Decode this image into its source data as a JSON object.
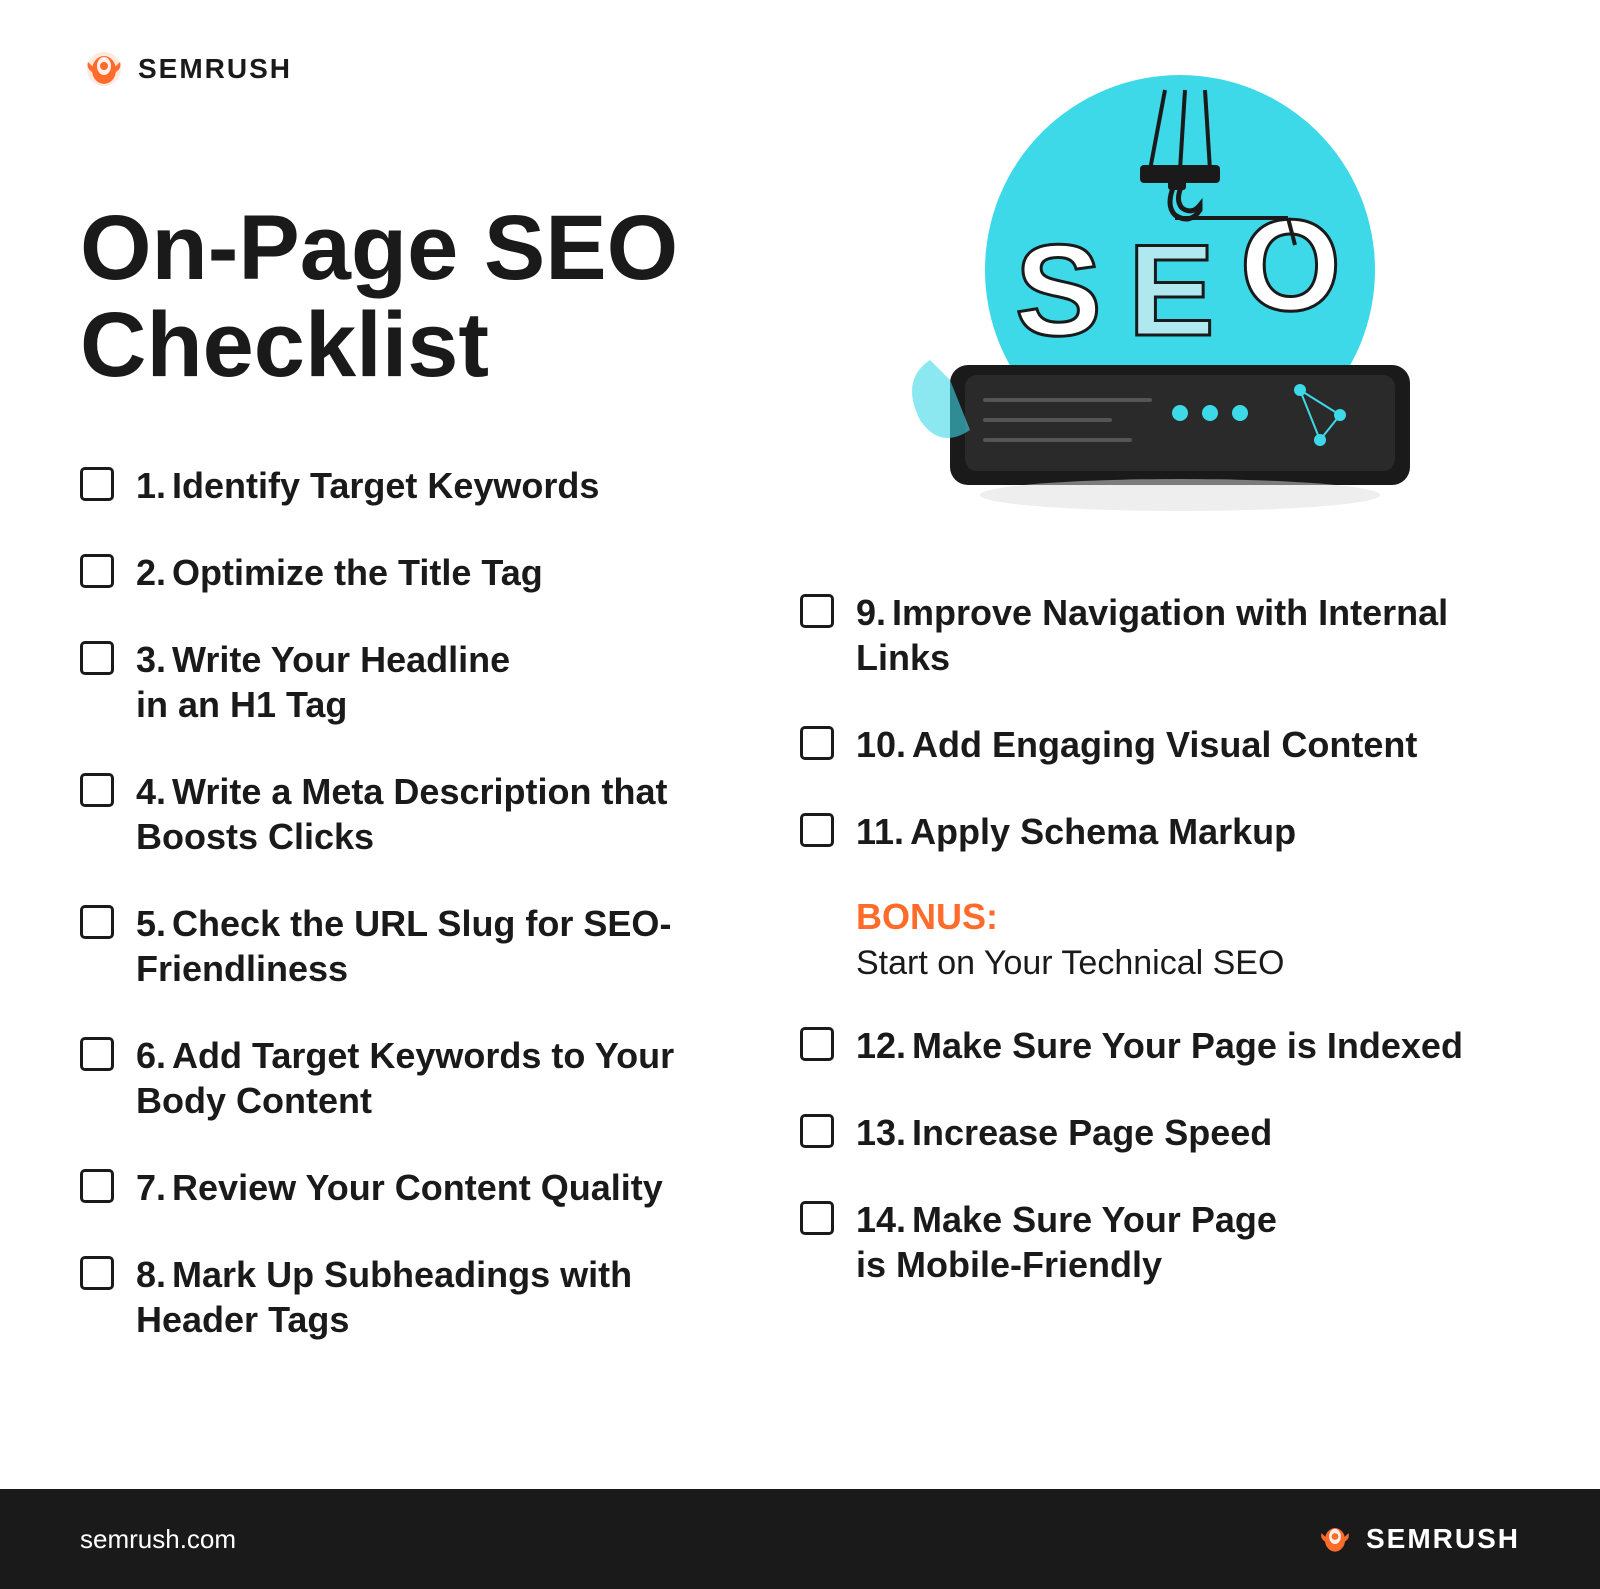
{
  "brand": {
    "name": "SEMRUSH",
    "website": "semrush.com",
    "color_primary": "#ff6b2b",
    "color_dark": "#1a1a1a",
    "color_light_blue": "#3dd9e8"
  },
  "page": {
    "title_line1": "On-Page SEO",
    "title_line2": "Checklist"
  },
  "left_items": [
    {
      "number": "1.",
      "text": "Identify Target Keywords"
    },
    {
      "number": "2.",
      "text": "Optimize the Title Tag"
    },
    {
      "number": "3.",
      "text": "Write Your Headline\nin an H1 Tag"
    },
    {
      "number": "4.",
      "text": "Write a Meta Description that\nBoosts Clicks"
    },
    {
      "number": "5.",
      "text": "Check the URL Slug for SEO-\nFriendliness"
    },
    {
      "number": "6.",
      "text": "Add Target Keywords to Your\nBody Content"
    },
    {
      "number": "7.",
      "text": "Review Your Content Quality"
    },
    {
      "number": "8.",
      "text": "Mark Up Subheadings with\nHeader Tags"
    }
  ],
  "right_items": [
    {
      "number": "9.",
      "text": "Improve Navigation with Internal\nLinks"
    },
    {
      "number": "10.",
      "text": "Add Engaging Visual Content"
    },
    {
      "number": "11.",
      "text": "Apply Schema Markup"
    }
  ],
  "bonus": {
    "label": "BONUS:",
    "text": "Start on Your Technical SEO"
  },
  "bonus_items": [
    {
      "number": "12.",
      "text": "Make Sure Your Page is Indexed"
    },
    {
      "number": "13.",
      "text": "Increase Page Speed"
    },
    {
      "number": "14.",
      "text": "Make Sure Your Page\nis Mobile-Friendly"
    }
  ]
}
